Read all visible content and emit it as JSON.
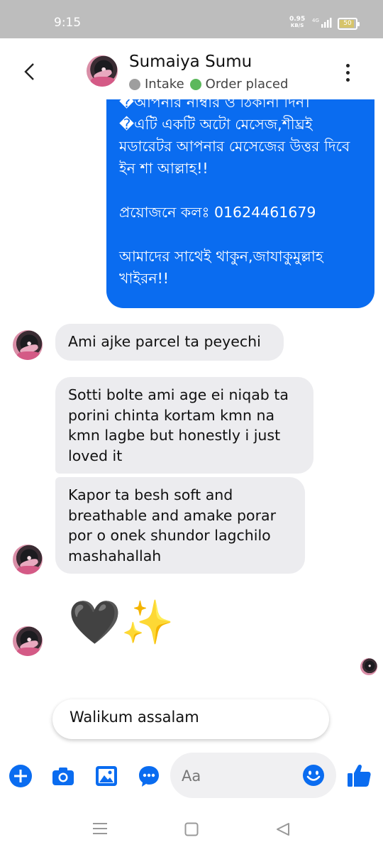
{
  "status_bar": {
    "time": "9:15",
    "speed_value": "0.95",
    "speed_unit": "KB/S",
    "network": "4G",
    "battery": "50"
  },
  "header": {
    "contact_name": "Sumaiya Sumu",
    "label_1": "Intake",
    "label_2": "Order placed",
    "label_1_color": "#9e9e9e",
    "label_2_color": "#5cb85c"
  },
  "outgoing_message": {
    "lines": [
      "�আপনার নাম্বার ও ঠিকানা দিন।",
      "�এটি একটি অটো মেসেজ,শীঘ্রই মডারেটর আপনার মেসেজের উত্তর দিবে ইন শা আল্লাহ!!",
      "",
      "প্রয়োজনে কলঃ 01624461679",
      "",
      "আমাদের সাথেই থাকুন,জাযাকুমুল্লাহ খাইরন!!"
    ]
  },
  "messages": [
    {
      "text": "Ami ajke parcel ta peyechi"
    },
    {
      "text": "Sotti bolte ami age ei niqab ta porini chinta kortam kmn na kmn lagbe but honestly i just loved it"
    },
    {
      "text": "Kapor ta besh soft and breathable and amake porar por o onek shundor lagchilo mashahallah"
    },
    {
      "text": "🖤✨"
    }
  ],
  "quick_reply": {
    "text": "Walikum assalam"
  },
  "composer": {
    "placeholder": "Aa"
  },
  "colors": {
    "accent": "#0a6cf0",
    "bubble_gray": "#ececef"
  },
  "icons": [
    "back-icon",
    "more-icon",
    "plus-icon",
    "camera-icon",
    "gallery-icon",
    "chat-bubble-icon",
    "emoji-icon",
    "thumbs-up-icon",
    "menu-icon",
    "home-icon",
    "back-nav-icon"
  ]
}
